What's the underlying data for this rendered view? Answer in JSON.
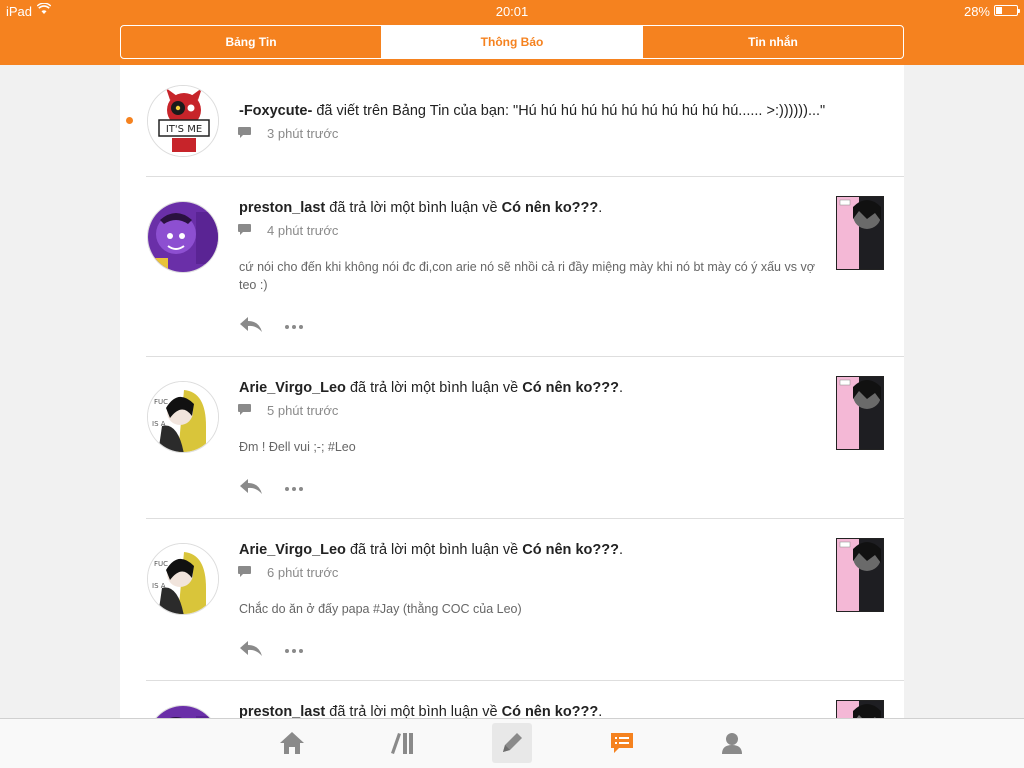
{
  "status_bar": {
    "device": "iPad",
    "time": "20:01",
    "battery": "28%",
    "battery_level": 0.28
  },
  "tabs": [
    {
      "label": "Bảng Tin",
      "active": false
    },
    {
      "label": "Thông Báo",
      "active": true
    },
    {
      "label": "Tin nhắn",
      "active": false
    }
  ],
  "notifications": [
    {
      "user": "-Foxycute-",
      "action": " đã viết trên Bảng Tin của bạn: \"Hú hú hú hú hú hú hú hú hú hú hú...... >:))))))...\"",
      "target": "",
      "time": "3 phút trước",
      "unread": true,
      "avatar_label": "IT'S ME"
    },
    {
      "user": "preston_last",
      "action": " đã trả lời một bình luận về ",
      "target": "Có nên ko???",
      "suffix": ".",
      "time": "4 phút trước",
      "comment": "cứ nói cho đến khi không nói đc đi,con arie nó sẽ nhồi cả ri đầy miệng mày khi nó bt mày có ý xấu vs vợ teo :)"
    },
    {
      "user": "Arie_Virgo_Leo",
      "action": " đã trả lời một bình luận về ",
      "target": "Có nên ko???",
      "suffix": ".",
      "time": "5 phút trước",
      "comment": "Đm ! Đell vui ;-; #Leo"
    },
    {
      "user": "Arie_Virgo_Leo",
      "action": " đã trả lời một bình luận về ",
      "target": "Có nên ko???",
      "suffix": ".",
      "time": "6 phút trước",
      "comment": "Chắc do ăn ở đấy papa #Jay (thằng COC của Leo)"
    },
    {
      "user": "preston_last",
      "action": " đã trả lời một bình luận về ",
      "target": "Có nên ko???",
      "suffix": ".",
      "time": "",
      "comment": ""
    }
  ],
  "tabbar": [
    "home-icon",
    "bookshelf-icon",
    "compose-icon",
    "notifications-icon",
    "profile-icon"
  ],
  "colors": {
    "accent": "#f5821f",
    "muted": "#8a8a8a"
  }
}
